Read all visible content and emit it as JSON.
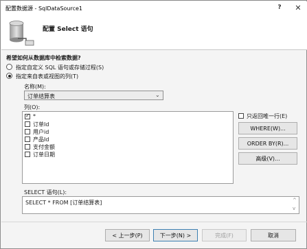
{
  "window": {
    "title": "配置数据源 - SqlDataSource1",
    "help_label": "?",
    "close_label": "✕"
  },
  "header": {
    "title": "配置 Select 语句",
    "icon": "database-icon"
  },
  "question": "希望如何从数据库中检索数据?",
  "options": [
    {
      "label": "指定自定义 SQL 语句或存储过程(S)",
      "checked": false
    },
    {
      "label": "指定来自表或视图的列(T)",
      "checked": true
    }
  ],
  "name_field": {
    "label": "名称(M):",
    "value": "订单结算表"
  },
  "columns": {
    "label": "列(O):",
    "items": [
      {
        "label": "*",
        "checked": true
      },
      {
        "label": "订单Id",
        "checked": false
      },
      {
        "label": "用户id",
        "checked": false
      },
      {
        "label": "产品Id",
        "checked": false
      },
      {
        "label": "支付金额",
        "checked": false
      },
      {
        "label": "订单日期",
        "checked": false
      }
    ]
  },
  "unique_rows": {
    "label": "只返回唯一行(E)",
    "checked": false
  },
  "side_buttons": {
    "where": "WHERE(W)...",
    "orderby": "ORDER BY(R)...",
    "advanced": "高级(V)..."
  },
  "sql": {
    "label": "SELECT 语句(L):",
    "text": "SELECT * FROM [订单结算表]"
  },
  "footer": {
    "prev": "< 上一步(P)",
    "next": "下一步(N) >",
    "finish": "完成(F)",
    "cancel": "取消"
  },
  "colors": {
    "accent": "#3c7fb1",
    "dialog_bg": "#f4f4f4"
  }
}
